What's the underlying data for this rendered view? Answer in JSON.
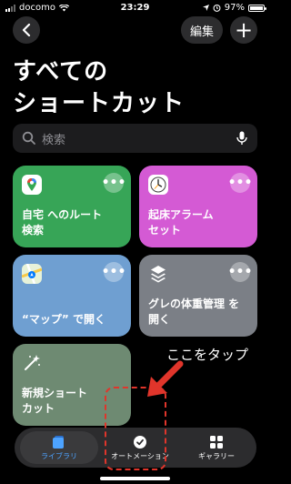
{
  "status_bar": {
    "carrier": "docomo",
    "time": "23:29",
    "battery": "97%",
    "battery_level": 0.97
  },
  "nav": {
    "edit_label": "編集",
    "plus_label": "+"
  },
  "page": {
    "title_line1": "すべての",
    "title_line2": "ショートカット"
  },
  "search": {
    "placeholder": "検索"
  },
  "tiles": [
    {
      "label_line1": "自宅 へのルート",
      "label_line2": "検索",
      "color": "#37a557",
      "icon": "map-pin-icon"
    },
    {
      "label_line1": "起床アラーム",
      "label_line2": "セット",
      "color": "#d45ad4",
      "icon": "clock-icon"
    },
    {
      "label_line1": "“マップ” で開く",
      "label_line2": "",
      "color": "#6f9fd1",
      "icon": "maps-icon"
    },
    {
      "label_line1": "グレの体重管理 を",
      "label_line2": "開く",
      "color": "#7b7f86",
      "icon": "layers-icon"
    },
    {
      "label_line1": "新規ショート",
      "label_line2": "カット",
      "color": "#6e8a72",
      "icon": "sparkle-wand-icon"
    }
  ],
  "more_symbol": "•••",
  "annotation": {
    "text": "ここをタップ",
    "color": "#e0352b"
  },
  "tab_bar": {
    "tabs": [
      {
        "label": "ライブラリ",
        "icon": "library-icon",
        "selected": true
      },
      {
        "label": "オートメーション",
        "icon": "automation-icon",
        "selected": false
      },
      {
        "label": "ギャラリー",
        "icon": "gallery-icon",
        "selected": false
      }
    ]
  }
}
